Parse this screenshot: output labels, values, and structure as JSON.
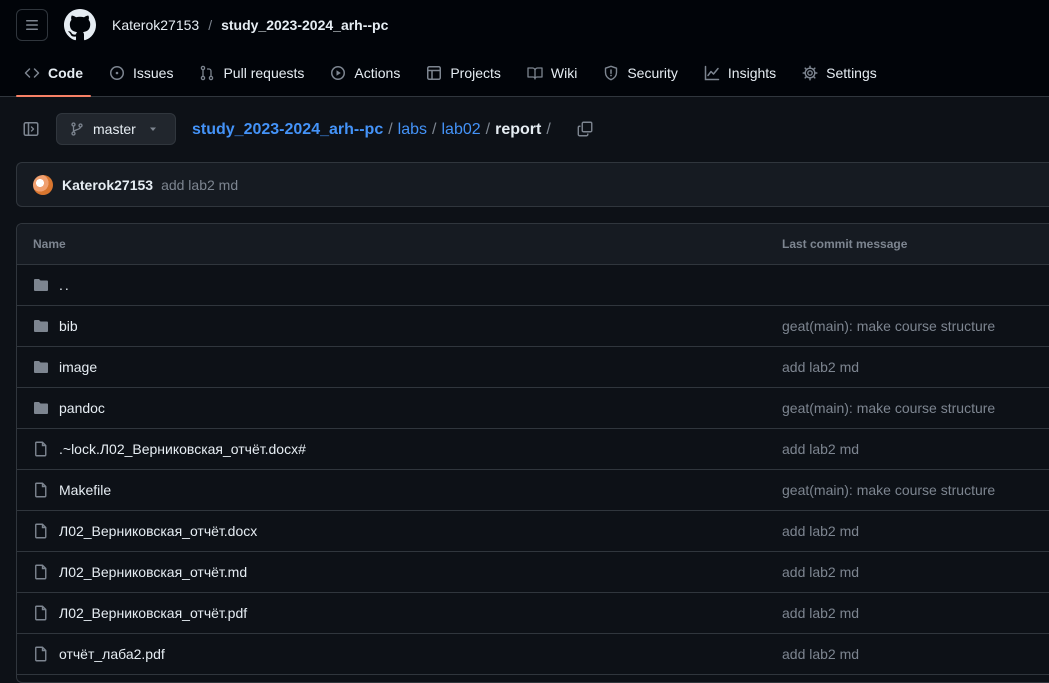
{
  "header": {
    "owner": "Katerok27153",
    "separator": "/",
    "repo": "study_2023-2024_arh--pc"
  },
  "tabs": [
    {
      "label": "Code",
      "icon": "code-icon",
      "active": true
    },
    {
      "label": "Issues",
      "icon": "issue-opened-icon"
    },
    {
      "label": "Pull requests",
      "icon": "git-pull-request-icon"
    },
    {
      "label": "Actions",
      "icon": "play-icon"
    },
    {
      "label": "Projects",
      "icon": "table-icon"
    },
    {
      "label": "Wiki",
      "icon": "book-icon"
    },
    {
      "label": "Security",
      "icon": "shield-icon"
    },
    {
      "label": "Insights",
      "icon": "graph-icon"
    },
    {
      "label": "Settings",
      "icon": "gear-icon"
    }
  ],
  "branch": {
    "label": "master"
  },
  "path": {
    "repo": "study_2023-2024_arh--pc",
    "segments": [
      "labs",
      "lab02"
    ],
    "current": "report",
    "sep": "/"
  },
  "latest_commit": {
    "author": "Katerok27153",
    "message": "add lab2 md"
  },
  "table": {
    "col_name": "Name",
    "col_message": "Last commit message",
    "rows": [
      {
        "type": "parent",
        "name": "..",
        "message": ""
      },
      {
        "type": "folder",
        "name": "bib",
        "message": "geat(main): make course structure"
      },
      {
        "type": "folder",
        "name": "image",
        "message": "add lab2 md"
      },
      {
        "type": "folder",
        "name": "pandoc",
        "message": "geat(main): make course structure"
      },
      {
        "type": "file",
        "name": ".~lock.Л02_Верниковская_отчёт.docx#",
        "message": "add lab2 md"
      },
      {
        "type": "file",
        "name": "Makefile",
        "message": "geat(main): make course structure"
      },
      {
        "type": "file",
        "name": "Л02_Верниковская_отчёт.docx",
        "message": "add lab2 md"
      },
      {
        "type": "file",
        "name": "Л02_Верниковская_отчёт.md",
        "message": "add lab2 md"
      },
      {
        "type": "file",
        "name": "Л02_Верниковская_отчёт.pdf",
        "message": "add lab2 md"
      },
      {
        "type": "file",
        "name": "отчёт_лаба2.pdf",
        "message": "add lab2 md"
      }
    ]
  },
  "colors": {
    "background": "#0d1117",
    "header_bg": "#010409",
    "link": "#4493f8",
    "muted": "#7d8590",
    "active_tab_underline": "#f78166"
  }
}
